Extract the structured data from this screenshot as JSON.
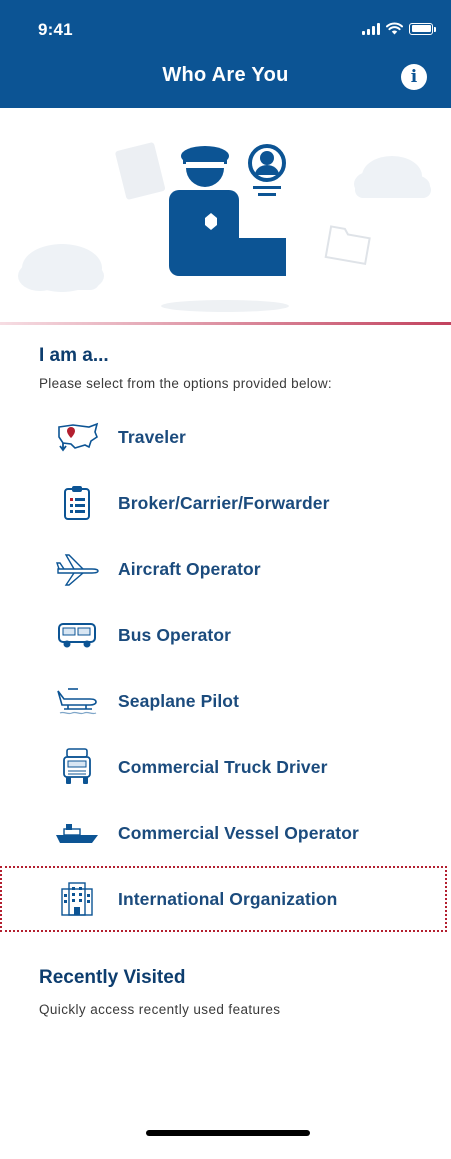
{
  "status_bar": {
    "time": "9:41"
  },
  "header": {
    "title": "Who Are You",
    "info_icon": "info-icon"
  },
  "colors": {
    "brand_blue": "#0c5494",
    "text_blue": "#1b4b7d",
    "accent_red": "#c2425e",
    "selection_outline": "#b31f2f"
  },
  "iam_section": {
    "title": "I am a...",
    "subtitle": "Please select from the options provided below:",
    "options": [
      {
        "label": "Traveler",
        "icon": "us-map-pin-icon"
      },
      {
        "label": "Broker/Carrier/Forwarder",
        "icon": "clipboard-icon"
      },
      {
        "label": "Aircraft Operator",
        "icon": "airplane-icon"
      },
      {
        "label": "Bus Operator",
        "icon": "bus-icon"
      },
      {
        "label": "Seaplane Pilot",
        "icon": "seaplane-icon"
      },
      {
        "label": "Commercial Truck Driver",
        "icon": "truck-icon"
      },
      {
        "label": "Commercial Vessel Operator",
        "icon": "ship-icon"
      },
      {
        "label": "International Organization",
        "icon": "building-icon",
        "selected": true
      }
    ]
  },
  "recent_section": {
    "title": "Recently Visited",
    "subtitle": "Quickly access recently used features"
  }
}
